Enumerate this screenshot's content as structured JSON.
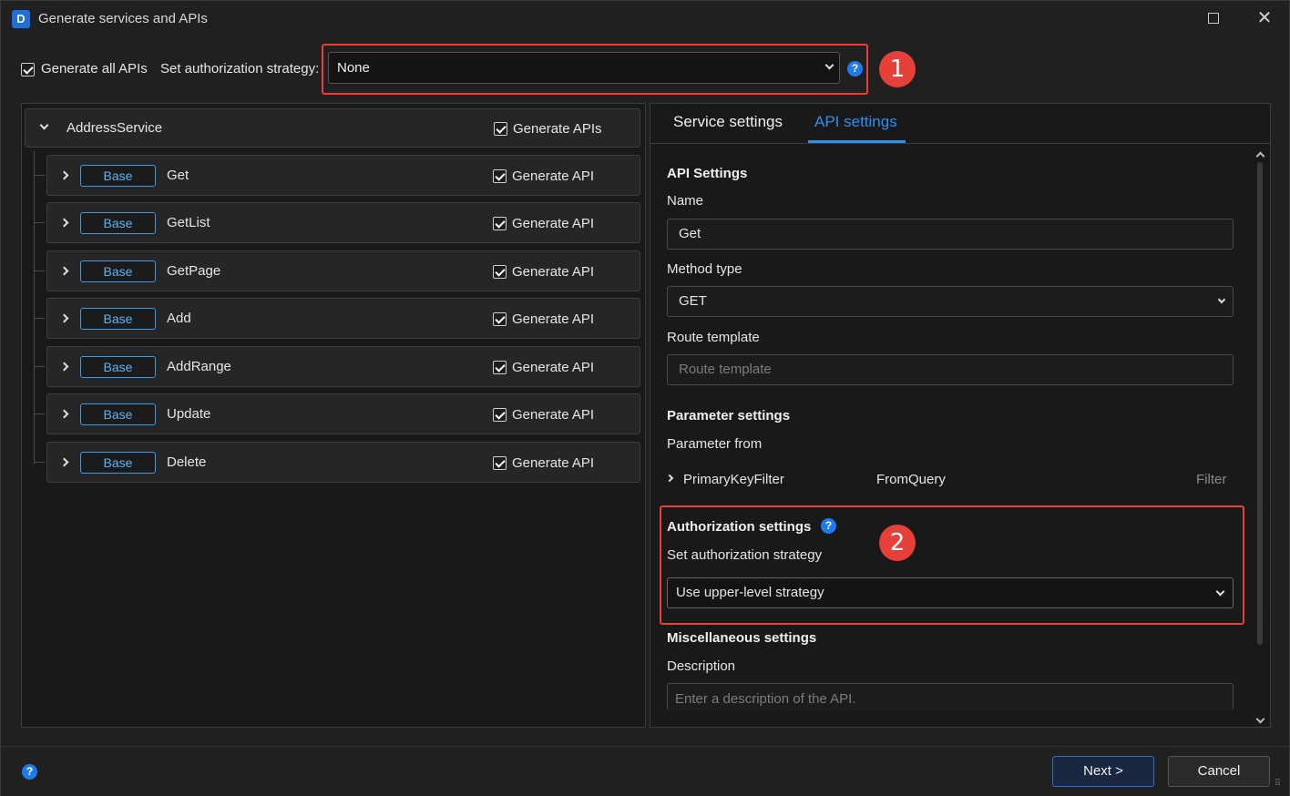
{
  "window": {
    "title": "Generate services and APIs",
    "app_icon_letter": "D"
  },
  "toprow": {
    "generate_all_label": "Generate all APIs",
    "generate_all_checked": true,
    "auth_strategy_label": "Set authorization strategy:",
    "auth_strategy_value": "None",
    "badge_1": "1"
  },
  "service": {
    "name": "AddressService",
    "generate_label": "Generate APIs",
    "generate_checked": true
  },
  "apis": [
    {
      "tag": "Base",
      "name": "Get",
      "generate_label": "Generate API",
      "checked": true
    },
    {
      "tag": "Base",
      "name": "GetList",
      "generate_label": "Generate API",
      "checked": true
    },
    {
      "tag": "Base",
      "name": "GetPage",
      "generate_label": "Generate API",
      "checked": true
    },
    {
      "tag": "Base",
      "name": "Add",
      "generate_label": "Generate API",
      "checked": true
    },
    {
      "tag": "Base",
      "name": "AddRange",
      "generate_label": "Generate API",
      "checked": true
    },
    {
      "tag": "Base",
      "name": "Update",
      "generate_label": "Generate API",
      "checked": true
    },
    {
      "tag": "Base",
      "name": "Delete",
      "generate_label": "Generate API",
      "checked": true
    }
  ],
  "tabs": {
    "service_settings": "Service settings",
    "api_settings": "API settings",
    "active": "api_settings"
  },
  "api_settings": {
    "heading": "API Settings",
    "name_label": "Name",
    "name_value": "Get",
    "method_label": "Method type",
    "method_value": "GET",
    "route_label": "Route template",
    "route_placeholder": "Route template"
  },
  "parameter_settings": {
    "heading": "Parameter settings",
    "from_label": "Parameter from",
    "param_name": "PrimaryKeyFilter",
    "param_source": "FromQuery",
    "param_type": "Filter"
  },
  "authorization_settings": {
    "heading": "Authorization settings",
    "strategy_label": "Set authorization strategy",
    "strategy_value": "Use upper-level strategy",
    "badge_2": "2"
  },
  "misc_settings": {
    "heading": "Miscellaneous settings",
    "description_label": "Description",
    "description_placeholder": "Enter a description of the API."
  },
  "footer": {
    "next_label": "Next >",
    "cancel_label": "Cancel"
  },
  "colors": {
    "accent": "#2f8ff0",
    "annotation_red": "#e5403a",
    "tag_blue": "#3c9be8"
  }
}
